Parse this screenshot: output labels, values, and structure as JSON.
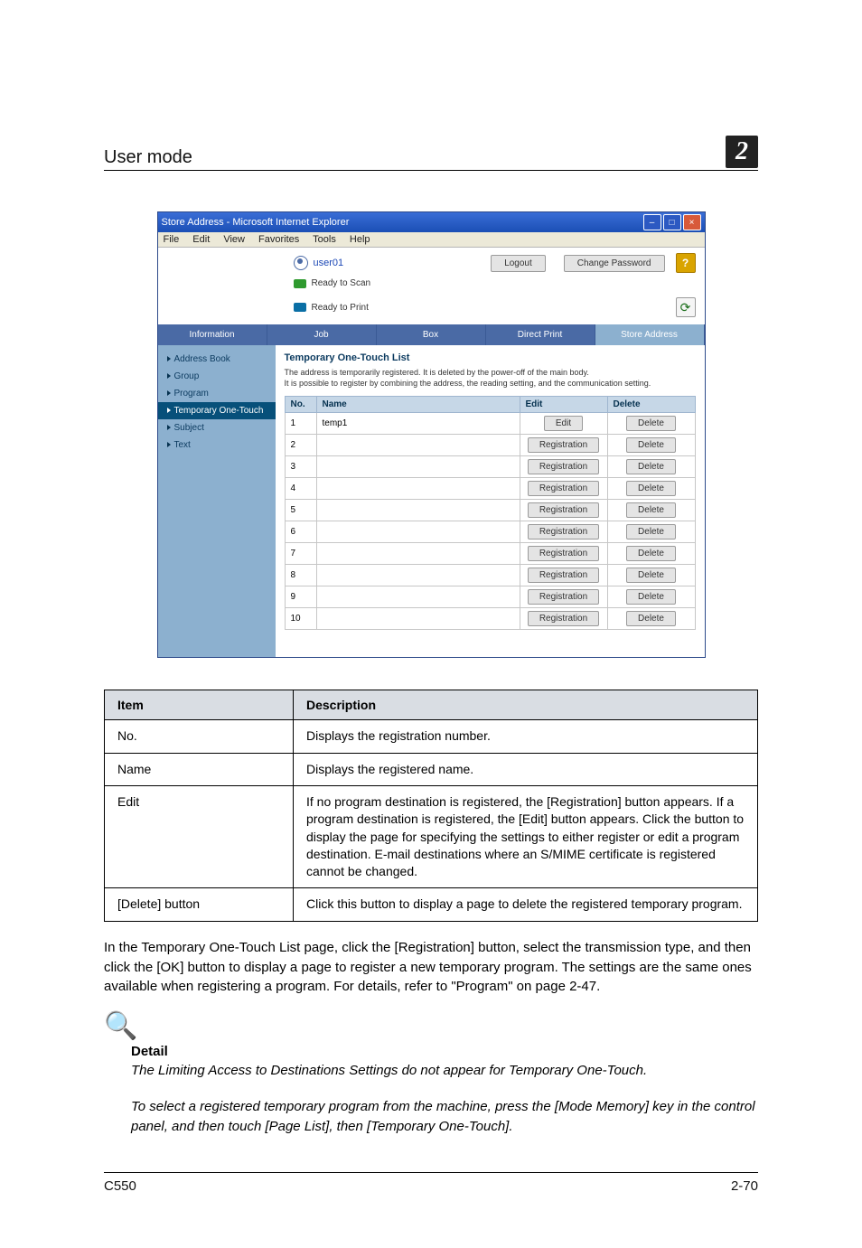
{
  "header": {
    "section": "User mode",
    "chapter": "2"
  },
  "window": {
    "title": "Store Address - Microsoft Internet Explorer",
    "menus": [
      "File",
      "Edit",
      "View",
      "Favorites",
      "Tools",
      "Help"
    ],
    "user": "user01",
    "logout": "Logout",
    "change_password": "Change Password",
    "help_icon": "?",
    "status1": "Ready to Scan",
    "status2": "Ready to Print",
    "refresh_icon": "⟳",
    "tabs": [
      "Information",
      "Job",
      "Box",
      "Direct Print",
      "Store Address"
    ],
    "active_tab": 4,
    "side_items": [
      "Address Book",
      "Group",
      "Program",
      "Temporary One-Touch",
      "Subject",
      "Text"
    ],
    "side_selected": 3,
    "content": {
      "heading": "Temporary One-Touch List",
      "desc1": "The address is temporarily registered. It is deleted by the power-off of the main body.",
      "desc2": "It is possible to register by combining the address, the reading setting, and the communication setting.",
      "cols": {
        "no": "No.",
        "name": "Name",
        "edit": "Edit",
        "delete": "Delete"
      },
      "rows": [
        {
          "no": "1",
          "name": "temp1",
          "edit": "Edit",
          "delete": "Delete"
        },
        {
          "no": "2",
          "name": "",
          "edit": "Registration",
          "delete": "Delete"
        },
        {
          "no": "3",
          "name": "",
          "edit": "Registration",
          "delete": "Delete"
        },
        {
          "no": "4",
          "name": "",
          "edit": "Registration",
          "delete": "Delete"
        },
        {
          "no": "5",
          "name": "",
          "edit": "Registration",
          "delete": "Delete"
        },
        {
          "no": "6",
          "name": "",
          "edit": "Registration",
          "delete": "Delete"
        },
        {
          "no": "7",
          "name": "",
          "edit": "Registration",
          "delete": "Delete"
        },
        {
          "no": "8",
          "name": "",
          "edit": "Registration",
          "delete": "Delete"
        },
        {
          "no": "9",
          "name": "",
          "edit": "Registration",
          "delete": "Delete"
        },
        {
          "no": "10",
          "name": "",
          "edit": "Registration",
          "delete": "Delete"
        }
      ]
    },
    "win_min": "–",
    "win_max": "□",
    "win_close": "×"
  },
  "info_table": {
    "head_item": "Item",
    "head_desc": "Description",
    "rows": [
      {
        "item": "No.",
        "desc": "Displays the registration number."
      },
      {
        "item": "Name",
        "desc": "Displays the registered name."
      },
      {
        "item": "Edit",
        "desc": "If no program destination is registered, the [Registration] button appears. If a program destination is registered, the [Edit] button appears. Click the button to display the page for specifying the settings to either register or edit a program destination. E-mail destinations where an S/MIME certificate is registered cannot be changed."
      },
      {
        "item": "[Delete] button",
        "desc": "Click this button to display a page to delete the registered temporary program."
      }
    ]
  },
  "body_para": "In the Temporary One-Touch List page, click the [Registration] button, select the transmission type, and then click the [OK] button to display a page to register a new temporary program. The settings are the same ones available when registering a program. For details, refer to \"Program\" on page 2-47.",
  "detail": {
    "heading": "Detail",
    "p1": "The Limiting Access to Destinations Settings do not appear for Temporary One-Touch.",
    "p2": "To select a registered temporary program from the machine, press the [Mode Memory] key in the control panel, and then touch [Page List], then [Temporary One-Touch]."
  },
  "footer": {
    "left": "C550",
    "right": "2-70"
  }
}
